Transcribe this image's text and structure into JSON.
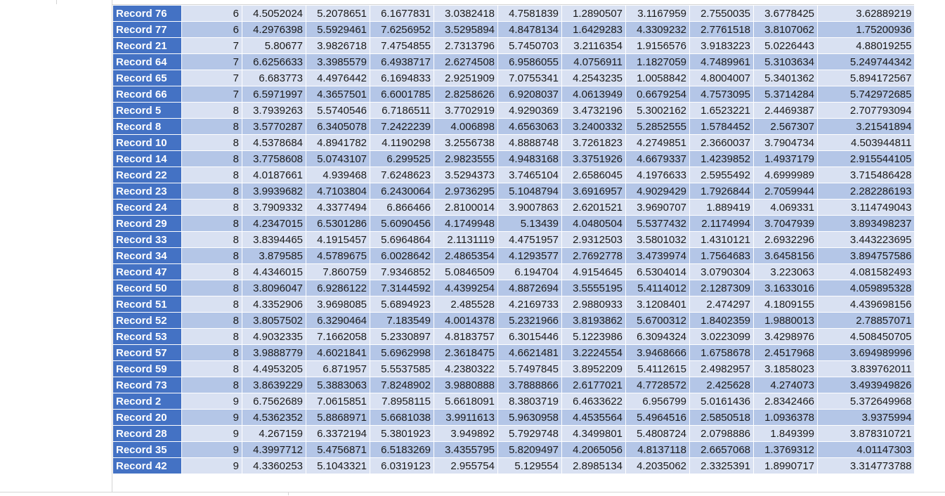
{
  "sheet": {
    "colors": {
      "record_header_bg": "#4472c4",
      "band_light": "#d9e1f2",
      "band_dark": "#b4c6e7"
    },
    "rows": [
      {
        "label": "Record 76",
        "values": [
          "6",
          "4.5052024",
          "5.2078651",
          "6.1677831",
          "3.0382418",
          "4.7581839",
          "1.2890507",
          "3.1167959",
          "2.7550035",
          "3.6778425",
          "3.62889219"
        ]
      },
      {
        "label": "Record 77",
        "values": [
          "6",
          "4.2976398",
          "5.5929461",
          "7.6256952",
          "3.5295894",
          "4.8478134",
          "1.6429283",
          "4.3309232",
          "2.7761518",
          "3.8107062",
          "1.75200936"
        ]
      },
      {
        "label": "Record 21",
        "values": [
          "7",
          "5.80677",
          "3.9826718",
          "7.4754855",
          "2.7313796",
          "5.7450703",
          "3.2116354",
          "1.9156576",
          "3.9183223",
          "5.0226443",
          "4.88019255"
        ]
      },
      {
        "label": "Record 64",
        "values": [
          "7",
          "6.6256633",
          "3.3985579",
          "6.4938717",
          "2.6274508",
          "6.9586055",
          "4.0756911",
          "1.1827059",
          "4.7489961",
          "5.3103634",
          "5.249744342"
        ]
      },
      {
        "label": "Record 65",
        "values": [
          "7",
          "6.683773",
          "4.4976442",
          "6.1694833",
          "2.9251909",
          "7.0755341",
          "4.2543235",
          "1.0058842",
          "4.8004007",
          "5.3401362",
          "5.894172567"
        ]
      },
      {
        "label": "Record 66",
        "values": [
          "7",
          "6.5971997",
          "4.3657501",
          "6.6001785",
          "2.8258626",
          "6.9208037",
          "4.0613949",
          "0.6679254",
          "4.7573095",
          "5.3714284",
          "5.742972685"
        ]
      },
      {
        "label": "Record 5",
        "values": [
          "8",
          "3.7939263",
          "5.5740546",
          "6.7186511",
          "3.7702919",
          "4.9290369",
          "3.4732196",
          "5.3002162",
          "1.6523221",
          "2.4469387",
          "2.707793094"
        ]
      },
      {
        "label": "Record 8",
        "values": [
          "8",
          "3.5770287",
          "6.3405078",
          "7.2422239",
          "4.006898",
          "4.6563063",
          "3.2400332",
          "5.2852555",
          "1.5784452",
          "2.567307",
          "3.21541894"
        ]
      },
      {
        "label": "Record 10",
        "values": [
          "8",
          "4.5378684",
          "4.8941782",
          "4.1190298",
          "3.2556738",
          "4.8888748",
          "3.7261823",
          "4.2749851",
          "2.3660037",
          "3.7904734",
          "4.503944811"
        ]
      },
      {
        "label": "Record 14",
        "values": [
          "8",
          "3.7758608",
          "5.0743107",
          "6.299525",
          "2.9823555",
          "4.9483168",
          "3.3751926",
          "4.6679337",
          "1.4239852",
          "1.4937179",
          "2.915544105"
        ]
      },
      {
        "label": "Record 22",
        "values": [
          "8",
          "4.0187661",
          "4.939468",
          "7.6248623",
          "3.5294373",
          "3.7465104",
          "2.6586045",
          "4.1976633",
          "2.5955492",
          "4.6999989",
          "3.715486428"
        ]
      },
      {
        "label": "Record 23",
        "values": [
          "8",
          "3.9939682",
          "4.7103804",
          "6.2430064",
          "2.9736295",
          "5.1048794",
          "3.6916957",
          "4.9029429",
          "1.7926844",
          "2.7059944",
          "2.282286193"
        ]
      },
      {
        "label": "Record 24",
        "values": [
          "8",
          "3.7909332",
          "4.3377494",
          "6.866466",
          "2.8100014",
          "3.9007863",
          "2.6201521",
          "3.9690707",
          "1.889419",
          "4.069331",
          "3.114749043"
        ]
      },
      {
        "label": "Record 29",
        "values": [
          "8",
          "4.2347015",
          "6.5301286",
          "5.6090456",
          "4.1749948",
          "5.13439",
          "4.0480504",
          "5.5377432",
          "2.1174994",
          "3.7047939",
          "3.893498237"
        ]
      },
      {
        "label": "Record 33",
        "values": [
          "8",
          "3.8394465",
          "4.1915457",
          "5.6964864",
          "2.1131119",
          "4.4751957",
          "2.9312503",
          "3.5801032",
          "1.4310121",
          "2.6932296",
          "3.443223695"
        ]
      },
      {
        "label": "Record 34",
        "values": [
          "8",
          "3.879585",
          "4.5789675",
          "6.0028642",
          "2.4865354",
          "4.1293577",
          "2.7692778",
          "3.4739974",
          "1.7564683",
          "3.6458156",
          "3.894757586"
        ]
      },
      {
        "label": "Record 47",
        "values": [
          "8",
          "4.4346015",
          "7.860759",
          "7.9346852",
          "5.0846509",
          "6.194704",
          "4.9154645",
          "6.5304014",
          "3.0790304",
          "3.223063",
          "4.081582493"
        ]
      },
      {
        "label": "Record 50",
        "values": [
          "8",
          "3.8096047",
          "6.9286122",
          "7.3144592",
          "4.4399254",
          "4.8872694",
          "3.5555195",
          "5.4114012",
          "2.1287309",
          "3.1633016",
          "4.059895328"
        ]
      },
      {
        "label": "Record 51",
        "values": [
          "8",
          "4.3352906",
          "3.9698085",
          "5.6894923",
          "2.485528",
          "4.2169733",
          "2.9880933",
          "3.1208401",
          "2.474297",
          "4.1809155",
          "4.439698156"
        ]
      },
      {
        "label": "Record 52",
        "values": [
          "8",
          "3.8057502",
          "6.3290464",
          "7.183549",
          "4.0014378",
          "5.2321966",
          "3.8193862",
          "5.6700312",
          "1.8402359",
          "1.9880013",
          "2.78857071"
        ]
      },
      {
        "label": "Record 53",
        "values": [
          "8",
          "4.9032335",
          "7.1662058",
          "5.2330897",
          "4.8183757",
          "6.3015446",
          "5.1223986",
          "6.3094324",
          "3.0223099",
          "3.4298976",
          "4.508450705"
        ]
      },
      {
        "label": "Record 57",
        "values": [
          "8",
          "3.9888779",
          "4.6021841",
          "5.6962998",
          "2.3618475",
          "4.6621481",
          "3.2224554",
          "3.9468666",
          "1.6758678",
          "2.4517968",
          "3.694989996"
        ]
      },
      {
        "label": "Record 59",
        "values": [
          "8",
          "4.4953205",
          "6.871957",
          "5.5537585",
          "4.2380322",
          "5.7497845",
          "3.8952209",
          "5.4112615",
          "2.4982957",
          "3.1858023",
          "3.839762011"
        ]
      },
      {
        "label": "Record 73",
        "values": [
          "8",
          "3.8639229",
          "5.3883063",
          "7.8248902",
          "3.9880888",
          "3.7888866",
          "2.6177021",
          "4.7728572",
          "2.425628",
          "4.274073",
          "3.493949826"
        ]
      },
      {
        "label": "Record 2",
        "values": [
          "9",
          "6.7562689",
          "7.0615851",
          "7.8958115",
          "5.6618091",
          "8.3803719",
          "6.4633622",
          "6.956799",
          "5.0161436",
          "2.8342466",
          "5.372649968"
        ]
      },
      {
        "label": "Record 20",
        "values": [
          "9",
          "4.5362352",
          "5.8868971",
          "5.6681038",
          "3.9911613",
          "5.9630958",
          "4.4535564",
          "5.4964516",
          "2.5850518",
          "1.0936378",
          "3.9375994"
        ]
      },
      {
        "label": "Record 28",
        "values": [
          "9",
          "4.267159",
          "6.3372194",
          "5.3801923",
          "3.949892",
          "5.7929748",
          "4.3499801",
          "5.4808724",
          "2.0798886",
          "1.849399",
          "3.878310721"
        ]
      },
      {
        "label": "Record 35",
        "values": [
          "9",
          "4.3997712",
          "5.4756871",
          "6.5183269",
          "3.4355795",
          "5.8209497",
          "4.2065056",
          "4.8137118",
          "2.6657068",
          "1.3769312",
          "4.01147303"
        ]
      },
      {
        "label": "Record 42",
        "values": [
          "9",
          "4.3360253",
          "5.1043321",
          "6.0319123",
          "2.955754",
          "5.129554",
          "2.8985134",
          "4.2035062",
          "2.3325391",
          "1.8990717",
          "3.314773788"
        ]
      }
    ]
  }
}
